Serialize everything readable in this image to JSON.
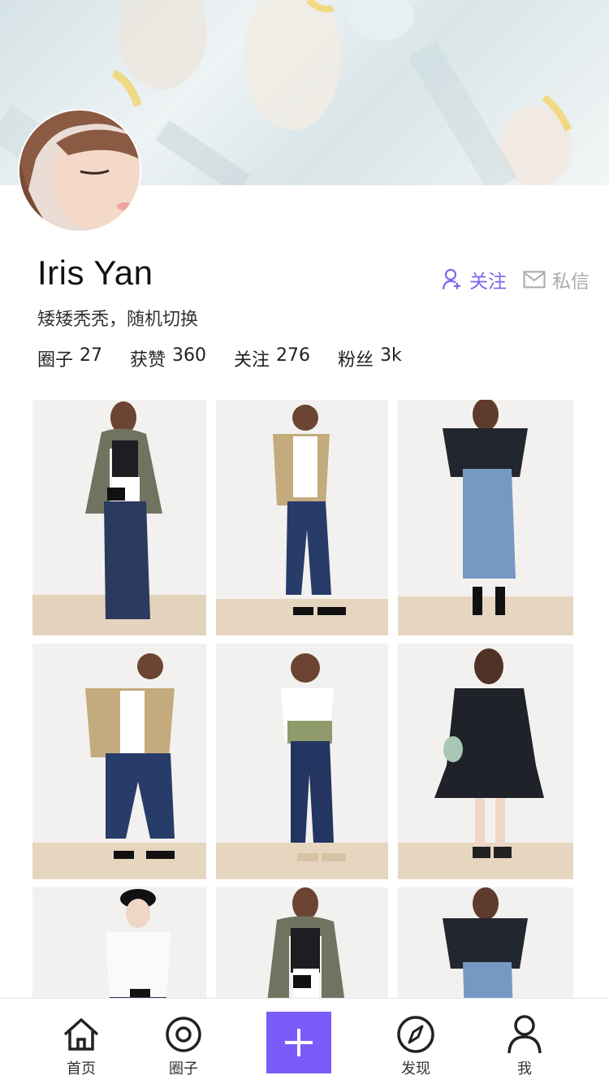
{
  "profile": {
    "name": "Iris Yan",
    "bio": "矮矮秃秃，随机切换",
    "stats": [
      {
        "label": "圈子",
        "value": "27"
      },
      {
        "label": "获赞",
        "value": "360"
      },
      {
        "label": "关注",
        "value": "276"
      },
      {
        "label": "粉丝",
        "value": "3k"
      }
    ]
  },
  "actions": {
    "follow_label": "关注",
    "message_label": "私信"
  },
  "colors": {
    "accent": "#7b5cfa",
    "follow_text": "#7b68ee",
    "muted": "#a9a9a9"
  },
  "grid": {
    "photos": [
      {
        "id": "outfit-olive-cardigan-denim"
      },
      {
        "id": "outfit-plaid-cardigan-jeans"
      },
      {
        "id": "outfit-polka-dot-shirt-denim-skirt"
      },
      {
        "id": "outfit-plaid-cardigan-jeans-2"
      },
      {
        "id": "outfit-floral-bustier-jeans"
      },
      {
        "id": "outfit-navy-dress"
      },
      {
        "id": "outfit-white-tee-beret"
      },
      {
        "id": "outfit-olive-cardigan-2"
      },
      {
        "id": "outfit-polka-dot-shirt-2"
      }
    ]
  },
  "tabbar": {
    "tabs": [
      {
        "label": "首页",
        "icon": "home-icon"
      },
      {
        "label": "圈子",
        "icon": "circle-target-icon"
      },
      {
        "label": "",
        "icon": "plus-icon"
      },
      {
        "label": "发现",
        "icon": "compass-icon"
      },
      {
        "label": "我",
        "icon": "user-icon"
      }
    ]
  }
}
